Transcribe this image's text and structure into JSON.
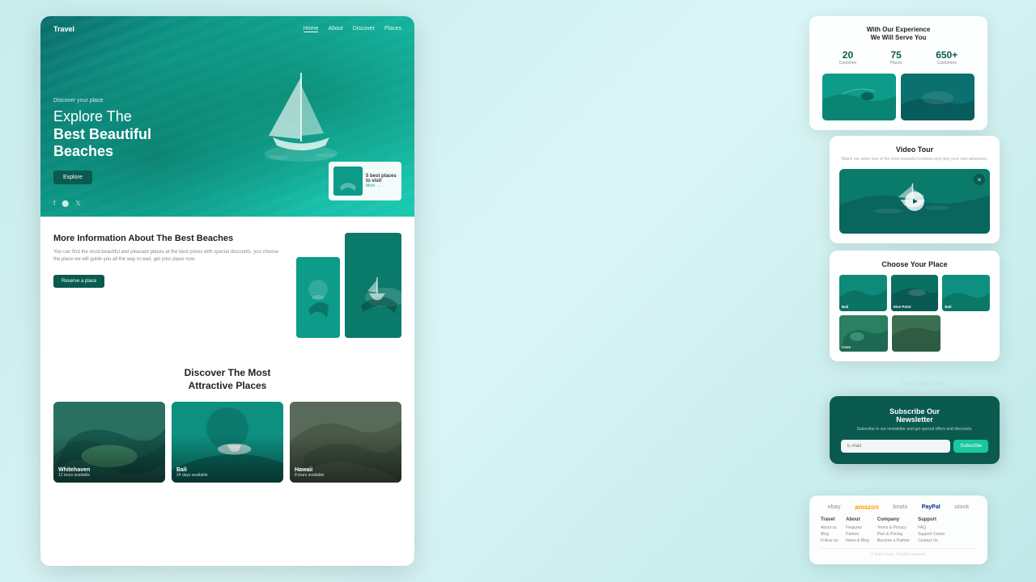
{
  "app": {
    "brand": "Travel",
    "nav_links": [
      "Home",
      "About",
      "Discover",
      "Places"
    ],
    "active_link": "Home"
  },
  "hero": {
    "sub_text": "Discover your place",
    "title_line1": "Explore The",
    "title_line2": "Best Beautiful",
    "title_line3": "Beaches",
    "cta_button": "Explore",
    "small_card_title": "5 best places",
    "small_card_sub": "to visit",
    "small_card_link": "More →"
  },
  "info_section": {
    "title": "More Information About The Best Beaches",
    "description": "You can find the most beautiful and pleasant places at the best prices with special discounts. you choose the place we will guide you all the way to wait, get your place now.",
    "button": "Reserve a place"
  },
  "discover_section": {
    "title_line1": "Discover The Most",
    "title_line2": "Attractive Places",
    "cards": [
      {
        "name": "Whitehaven",
        "sub": "12 tours available"
      },
      {
        "name": "Bali",
        "sub": "24 days available"
      },
      {
        "name": "Hawaii",
        "sub": "8 tours available"
      }
    ]
  },
  "stats": {
    "title_line1": "With Our Experience",
    "title_line2": "We Will Serve You",
    "items": [
      {
        "number": "20",
        "label": "Countries"
      },
      {
        "number": "75",
        "label": "Places"
      },
      {
        "number": "650+",
        "label": "Customers"
      }
    ]
  },
  "video_tour": {
    "title": "Video Tour",
    "description": "Watch our video tour of the most beautiful locations and plan your next adventure."
  },
  "choose_place": {
    "title": "Choose Your Place",
    "places": [
      {
        "label": "Bali"
      },
      {
        "label": "Dive Point"
      },
      {
        "label": "Bali"
      },
      {
        "label": "Cove"
      },
      {
        "label": ""
      }
    ]
  },
  "newsletter": {
    "title_line1": "Subscribe Our",
    "title_line2": "Newsletter",
    "description": "Subscribe to our newsletter and get special offers and discounts.",
    "input_placeholder": "E-mail",
    "button": "Subscribe"
  },
  "footer": {
    "logos": [
      "ebay",
      "amazon",
      "beats",
      "PayPal",
      "stock"
    ],
    "columns": [
      {
        "title": "Travel",
        "items": [
          "About us",
          "Blog",
          "Follow us"
        ]
      },
      {
        "title": "About",
        "items": [
          "Features",
          "Partner",
          "News & Blog"
        ]
      },
      {
        "title": "Company",
        "items": [
          "Terms & Privacy",
          "Plan & Pricing",
          "Become a Partner"
        ]
      },
      {
        "title": "Support",
        "items": [
          "FAQ",
          "Support Center",
          "Contact Us"
        ]
      }
    ]
  },
  "watermark": {
    "text": "mostaqi.com"
  }
}
